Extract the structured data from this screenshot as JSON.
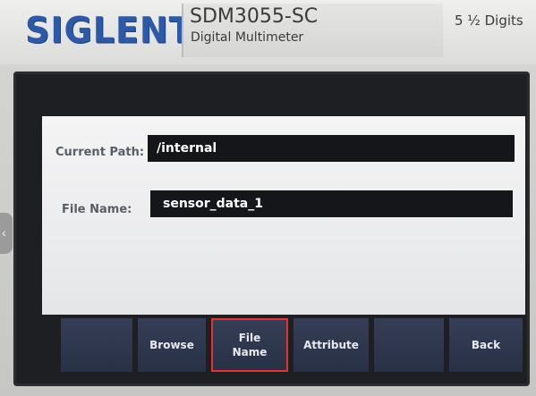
{
  "device": {
    "brand_logo": "SIGLENT",
    "model": "SDM3055-SC",
    "subtitle": "Digital Multimeter",
    "resolution": "5 ½ Digits"
  },
  "screen": {
    "current_path_label": "Current Path:",
    "current_path_value": "/internal",
    "file_name_label": "File Name:",
    "file_name_value": "sensor_data_1"
  },
  "softkeys": {
    "key1": "",
    "key2": "Browse",
    "key3_line1": "File",
    "key3_line2": "Name",
    "key4": "Attribute",
    "key5": "",
    "key6": "Back",
    "selected": "File Name"
  },
  "colors": {
    "logo_blue": "#2c5aa8",
    "softkey_bg": "#2e3750",
    "selection_border": "#e8302c",
    "field_bg": "#15161a"
  },
  "icons": {
    "side_tab": "chevron-left-icon"
  }
}
